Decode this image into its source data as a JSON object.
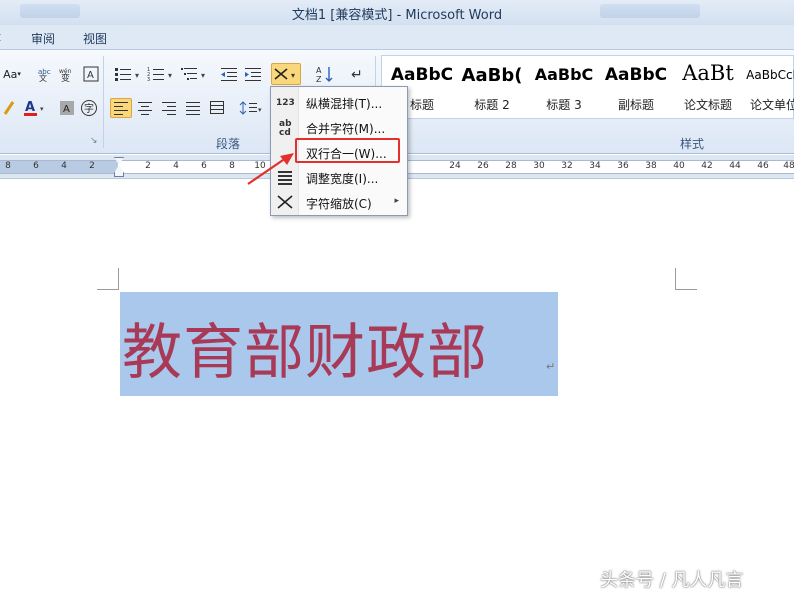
{
  "window": {
    "title": "文档1 [兼容模式] - Microsoft Word"
  },
  "tabs": [
    {
      "label": "审阅"
    },
    {
      "label": "视图"
    }
  ],
  "ribbon": {
    "paragraph_group_label": "段落",
    "styles_group_label": "样式",
    "font_size_button": "Aa",
    "styles": [
      {
        "sample": "AaBbC",
        "name": "标题"
      },
      {
        "sample": "AaBb(",
        "name": "标题 2"
      },
      {
        "sample": "AaBbC",
        "name": "标题 3"
      },
      {
        "sample": "AaBbC",
        "name": "副标题"
      },
      {
        "sample": "AaBt",
        "name": "论文标题"
      },
      {
        "sample": "AaBbCcD",
        "name": "论文单位"
      }
    ]
  },
  "ruler": {
    "ticks": [
      "8",
      "6",
      "4",
      "2",
      "2",
      "4",
      "6",
      "8",
      "10",
      "24",
      "26",
      "28",
      "30",
      "32",
      "34",
      "36",
      "38",
      "40",
      "42",
      "44",
      "46",
      "48"
    ]
  },
  "menu": {
    "items": [
      {
        "icon": "vertical-text-icon",
        "icon_text": "123",
        "label": "纵横混排(T)...",
        "submenu": false
      },
      {
        "icon": "combine-chars-icon",
        "icon_text": "ab cd",
        "label": "合并字符(M)...",
        "submenu": false
      },
      {
        "icon": "two-lines-in-one-icon",
        "icon_text": "",
        "label": "双行合一(W)...",
        "submenu": false
      },
      {
        "icon": "adjust-width-icon",
        "icon_text": "",
        "label": "调整宽度(I)...",
        "submenu": false
      },
      {
        "icon": "character-scale-icon",
        "icon_text": "",
        "label": "字符缩放(C)",
        "submenu": true
      }
    ],
    "highlighted_item": "双行合一(W)...",
    "submenu_arrow": "▸"
  },
  "document": {
    "text": "教育部财政部",
    "paragraph_mark": "↵"
  },
  "watermark": {
    "text": "头条号 / 凡人凡言"
  },
  "colors": {
    "selection": "#a9c8ec",
    "document_text": "#a83a57",
    "highlight_box": "#e3302d",
    "active_button": "#fbd77c"
  }
}
